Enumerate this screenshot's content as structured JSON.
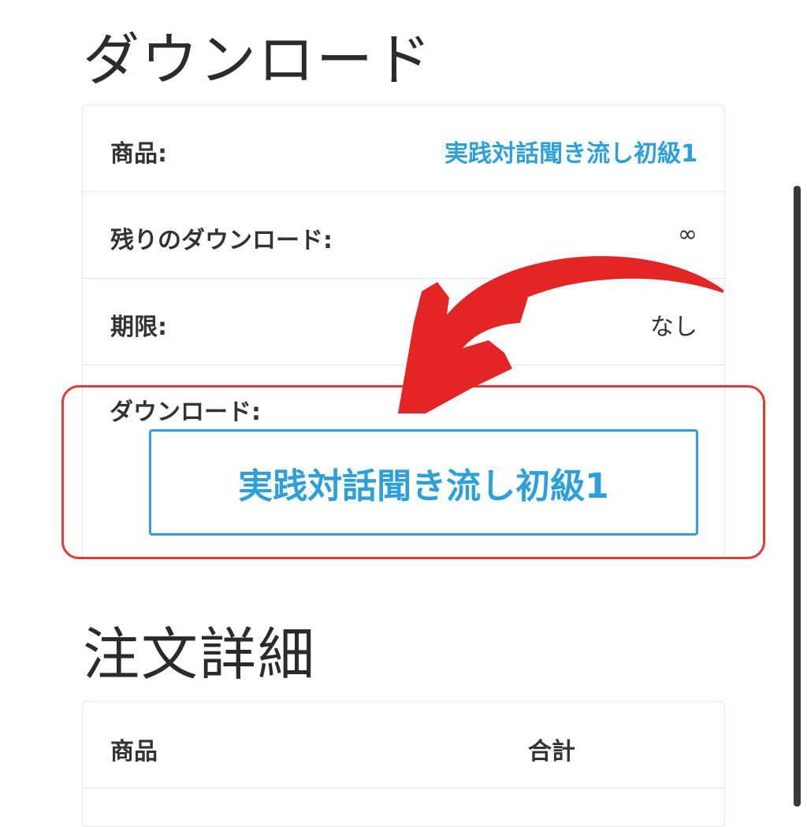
{
  "download_section": {
    "title": "ダウンロード",
    "rows": {
      "product_label": "商品:",
      "product_value": "実践対話聞き流し初級1",
      "remaining_label": "残りのダウンロード:",
      "remaining_value": "∞",
      "expiry_label": "期限:",
      "expiry_value": "なし"
    },
    "download_label": "ダウンロード:",
    "download_button": "実践対話聞き流し初級1"
  },
  "order_details": {
    "title": "注文詳細",
    "header_product": "商品",
    "header_total": "合計"
  },
  "colors": {
    "link": "#2d9fdc",
    "annotation": "#e32526"
  }
}
